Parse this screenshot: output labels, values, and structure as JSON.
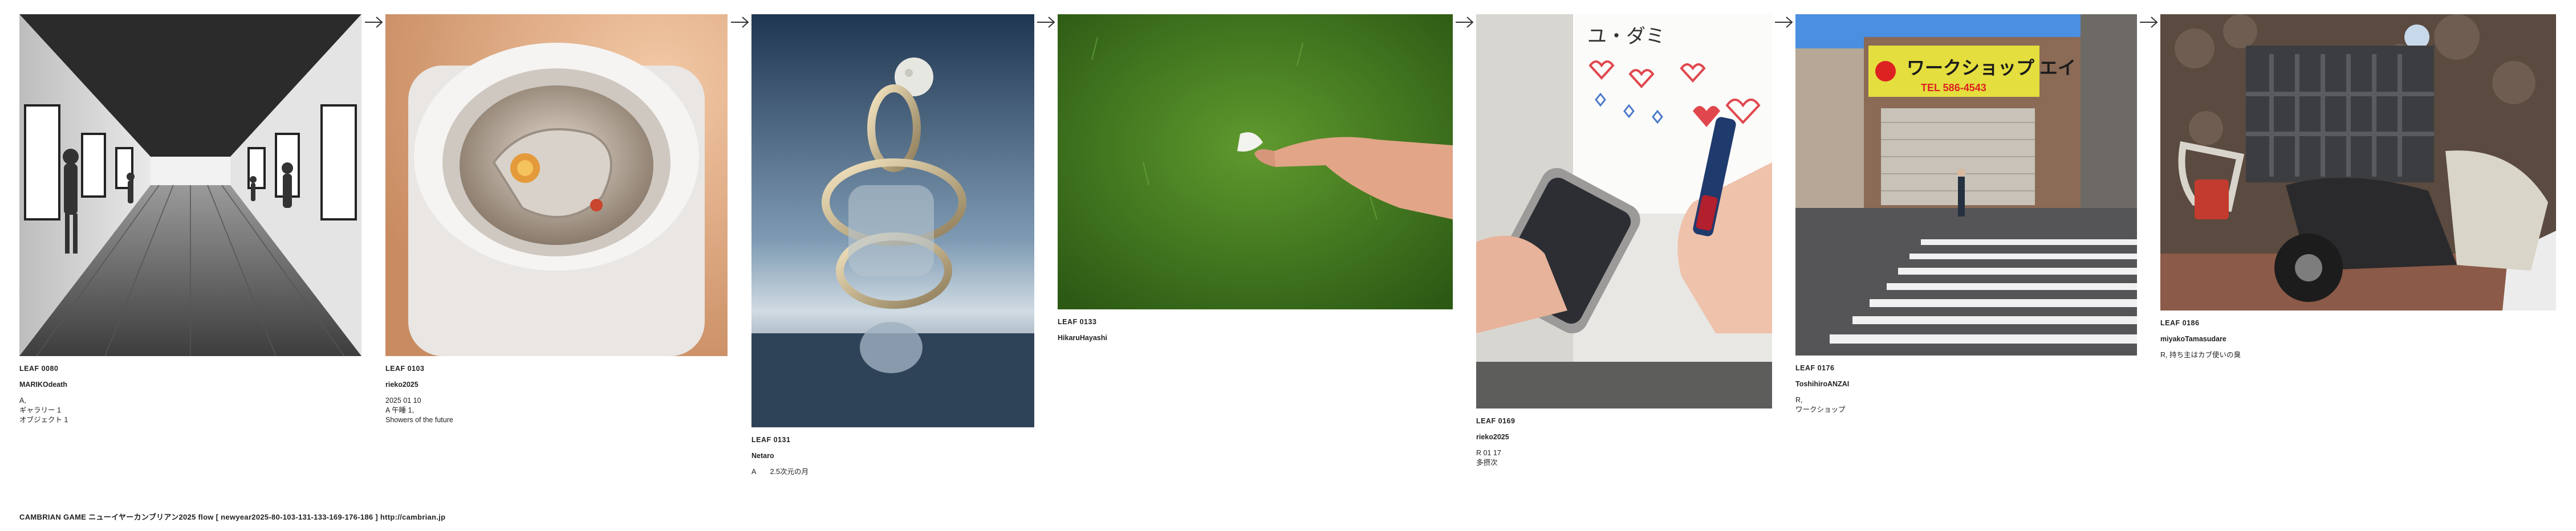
{
  "leaves": [
    {
      "id": "LEAF 0080",
      "author": "MARIKOdeath",
      "caption": "A,\nギャラリー 1\nオブジェクト 1"
    },
    {
      "id": "LEAF 0103",
      "author": "rieko2025",
      "caption": "2025 01 10\nA 午睡 1,\nShowers of the future"
    },
    {
      "id": "LEAF 0131",
      "author": "Netaro",
      "caption": "A　　2.5次元の月"
    },
    {
      "id": "LEAF 0133",
      "author": "HikaruHayashi",
      "caption": ""
    },
    {
      "id": "LEAF 0169",
      "author": "rieko2025",
      "caption": "R 01 17\n多摂次"
    },
    {
      "id": "LEAF 0176",
      "author": "ToshihiroANZAI",
      "caption": "R,\nワークショップ"
    },
    {
      "id": "LEAF 0186",
      "author": "miyakoTamasudare",
      "caption": "R, 持ち主はカブ使いの臭"
    }
  ],
  "footer": "CAMBRIAN GAME  ニューイヤーカンブリアン2025  flow [ newyear2025-80-103-131-133-169-176-186 ]    http://cambrian.jp",
  "image_text": {
    "shop_sign": "ワークショップ エイト",
    "shop_phone": "TEL 586-4543",
    "whiteboard": "ユ・ダミ"
  }
}
